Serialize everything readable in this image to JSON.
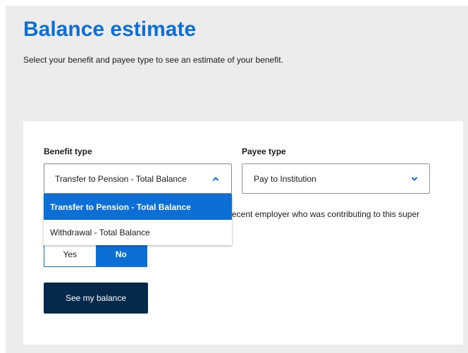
{
  "page": {
    "title": "Balance estimate",
    "subtitle": "Select your benefit and payee type to see an estimate of your benefit."
  },
  "form": {
    "benefit_type": {
      "label": "Benefit type",
      "selected_value": "Transfer to Pension - Total Balance",
      "open": true,
      "options": [
        "Transfer to Pension - Total Balance",
        "Withdrawal - Total Balance"
      ]
    },
    "payee_type": {
      "label": "Payee type",
      "selected_value": "Pay to Institution"
    },
    "question_text": "ecent employer who was contributing to this super",
    "employer_toggle": {
      "options": [
        "Yes",
        "No"
      ],
      "selected": "No"
    },
    "submit_label": "See my balance"
  },
  "icons": {
    "benefit_dropdown": "chevron-up-icon",
    "payee_dropdown": "chevron-down-icon"
  },
  "colors": {
    "accent": "#0B6FD6",
    "background": "#ECECEC",
    "card": "#FFFFFF",
    "button": "#05294D",
    "text": "#1C1C1C"
  }
}
